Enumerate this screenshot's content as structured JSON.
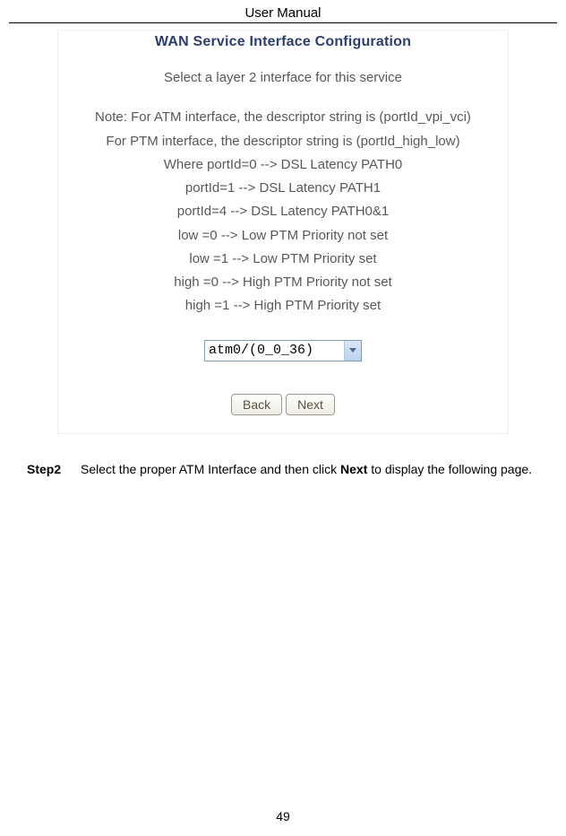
{
  "header": {
    "title": "User Manual"
  },
  "figure": {
    "title": "WAN Service Interface Configuration",
    "subtitle": "Select a layer 2 interface for this service",
    "note_lines": [
      "Note: For ATM interface, the descriptor string is (portId_vpi_vci)",
      "For PTM interface, the descriptor string is (portId_high_low)",
      "Where portId=0 --> DSL Latency PATH0",
      "portId=1 --> DSL Latency PATH1",
      "portId=4 --> DSL Latency PATH0&1",
      "low =0 --> Low PTM Priority not set",
      "low =1 --> Low PTM Priority set",
      "high =0 --> High PTM Priority not set",
      "high =1 --> High PTM Priority set"
    ],
    "select_value": "atm0/(0_0_36)",
    "buttons": {
      "back": "Back",
      "next": "Next"
    }
  },
  "step": {
    "label": "Step2",
    "text_prefix": "Select the proper ATM Interface and then click ",
    "text_bold": "Next",
    "text_suffix": " to display the following page."
  },
  "page_number": "49"
}
